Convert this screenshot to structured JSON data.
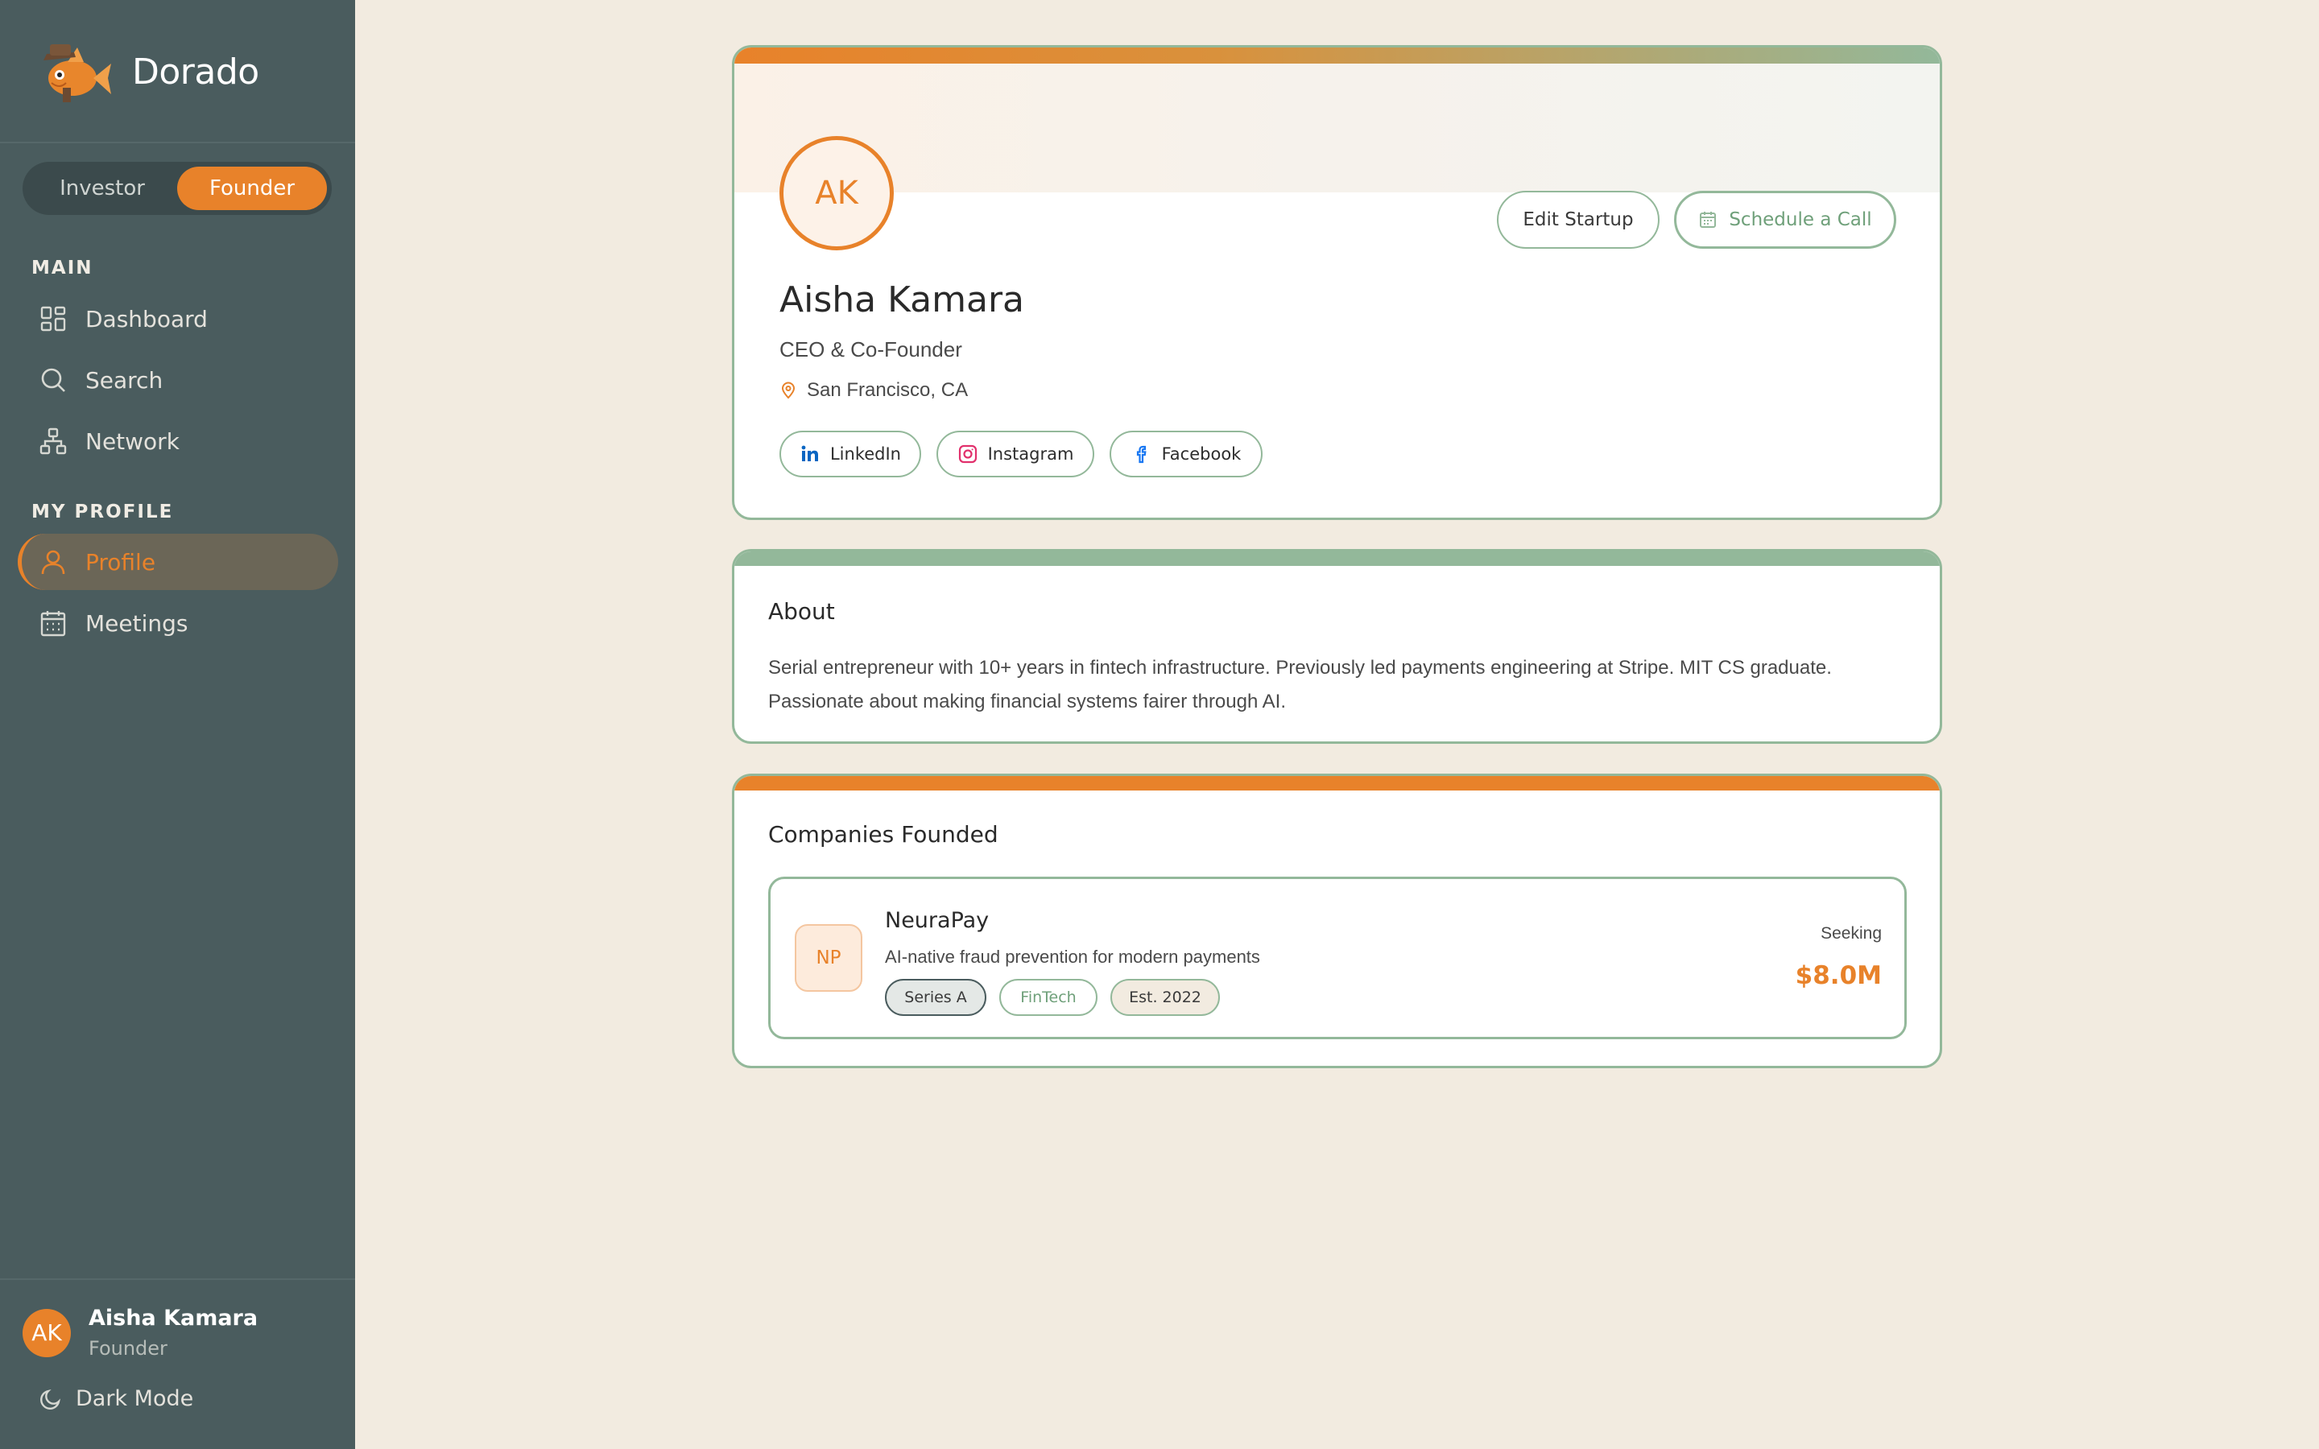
{
  "app": {
    "name": "Dorado",
    "logo_icon": "goldfish-detective-logo"
  },
  "role_toggle": {
    "investor": "Investor",
    "founder": "Founder",
    "active": "Founder"
  },
  "sidebar": {
    "main_label": "MAIN",
    "main_items": [
      {
        "label": "Dashboard",
        "icon": "dashboard-icon"
      },
      {
        "label": "Search",
        "icon": "search-icon"
      },
      {
        "label": "Network",
        "icon": "network-icon"
      }
    ],
    "profile_label": "MY PROFILE",
    "profile_items": [
      {
        "label": "Profile",
        "icon": "user-icon",
        "active": true
      },
      {
        "label": "Meetings",
        "icon": "calendar-icon"
      }
    ],
    "user": {
      "initials": "AK",
      "name": "Aisha Kamara",
      "role": "Founder"
    },
    "dark_mode": "Dark Mode"
  },
  "profile": {
    "initials": "AK",
    "name": "Aisha Kamara",
    "title": "CEO & Co-Founder",
    "location": "San Francisco, CA",
    "edit_button": "Edit Startup",
    "call_button": "Schedule a Call",
    "socials": [
      {
        "label": "LinkedIn",
        "icon": "linkedin-icon",
        "color": "#0a66c2"
      },
      {
        "label": "Instagram",
        "icon": "instagram-icon",
        "color": "#e1306c"
      },
      {
        "label": "Facebook",
        "icon": "facebook-icon",
        "color": "#1877f2"
      }
    ]
  },
  "about": {
    "heading": "About",
    "text": "Serial entrepreneur with 10+ years in fintech infrastructure. Previously led payments engineering at Stripe. MIT CS graduate. Passionate about making financial systems fairer through AI."
  },
  "companies": {
    "heading": "Companies Founded",
    "items": [
      {
        "initials": "NP",
        "name": "NeuraPay",
        "description": "AI-native fraud prevention for modern payments",
        "tags": [
          "Series A",
          "FinTech",
          "Est. 2022"
        ],
        "seeking_label": "Seeking",
        "seeking_amount": "$8.0M"
      }
    ]
  },
  "colors": {
    "accent": "#e8822a",
    "sage": "#93b89a",
    "sidebar": "#4a5c5e",
    "background": "#f2ebe0"
  }
}
